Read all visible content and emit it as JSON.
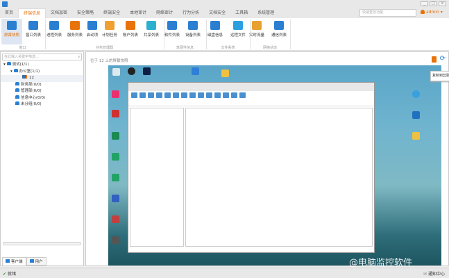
{
  "titlebar": {
    "controls": [
      "_",
      "□",
      "×"
    ]
  },
  "tabs": [
    {
      "label": "首页"
    },
    {
      "label": "终端信息",
      "active": true
    },
    {
      "label": "文档加密"
    },
    {
      "label": "安全策略"
    },
    {
      "label": "终端安全"
    },
    {
      "label": "本地审计"
    },
    {
      "label": "网络审计"
    },
    {
      "label": "行为分析"
    },
    {
      "label": "文档安全"
    },
    {
      "label": "工具箱"
    },
    {
      "label": "系统管理"
    }
  ],
  "search": {
    "placeholder": "快速查找功能"
  },
  "user": {
    "name": "admin ▾"
  },
  "ribbon": {
    "buttons": [
      {
        "label": "屏幕快照",
        "icon": "camera-icon",
        "color": "#2b7fd0",
        "selected": true
      },
      {
        "label": "窗口列表",
        "icon": "window-icon",
        "color": "#2b7fd0"
      },
      {
        "label": "进程列表",
        "icon": "process-icon",
        "color": "#2b7fd0"
      },
      {
        "label": "服务列表",
        "icon": "service-icon",
        "color": "#e8730b"
      },
      {
        "label": "启动项",
        "icon": "startup-icon",
        "color": "#2b7fd0"
      },
      {
        "label": "计划任务",
        "icon": "pencil-icon",
        "color": "#f0a030"
      },
      {
        "label": "账户列表",
        "icon": "account-icon",
        "color": "#e8730b"
      },
      {
        "label": "共享列表",
        "icon": "share-icon",
        "color": "#2bb0d0"
      },
      {
        "label": "软件列表",
        "icon": "software-icon",
        "color": "#2b7fd0"
      },
      {
        "label": "设备列表",
        "icon": "device-icon",
        "color": "#2b7fd0"
      },
      {
        "label": "磁盘信息",
        "icon": "disk-icon",
        "color": "#2b7fd0"
      },
      {
        "label": "远程文件",
        "icon": "folder-icon",
        "color": "#2b9fe0"
      },
      {
        "label": "实时流量",
        "icon": "traffic-icon",
        "color": "#e8a030"
      },
      {
        "label": "通信列表",
        "icon": "phone-icon",
        "color": "#2b7fd0"
      }
    ],
    "groups": [
      "窗口",
      "任务管理器",
      "软硬件信息",
      "文件系统",
      "网络状态"
    ]
  },
  "tree": {
    "search_placeholder": "在此输入关键字筛选...",
    "nodes": [
      "测试(1/1)",
      "办公室(1/1)",
      "12",
      "财务部(0/0)",
      "管理部(0/0)",
      "信息中心(0/0)",
      "未分组(0/0)"
    ]
  },
  "bottom_tabs": [
    "客户端",
    "用户"
  ],
  "main": {
    "title": "位于 12 上的屏幕快照",
    "tooltip": "复制到剪贴板"
  },
  "status": {
    "ready": "就绪",
    "notify": "通知中心"
  },
  "watermark": "@电脑监控软件"
}
